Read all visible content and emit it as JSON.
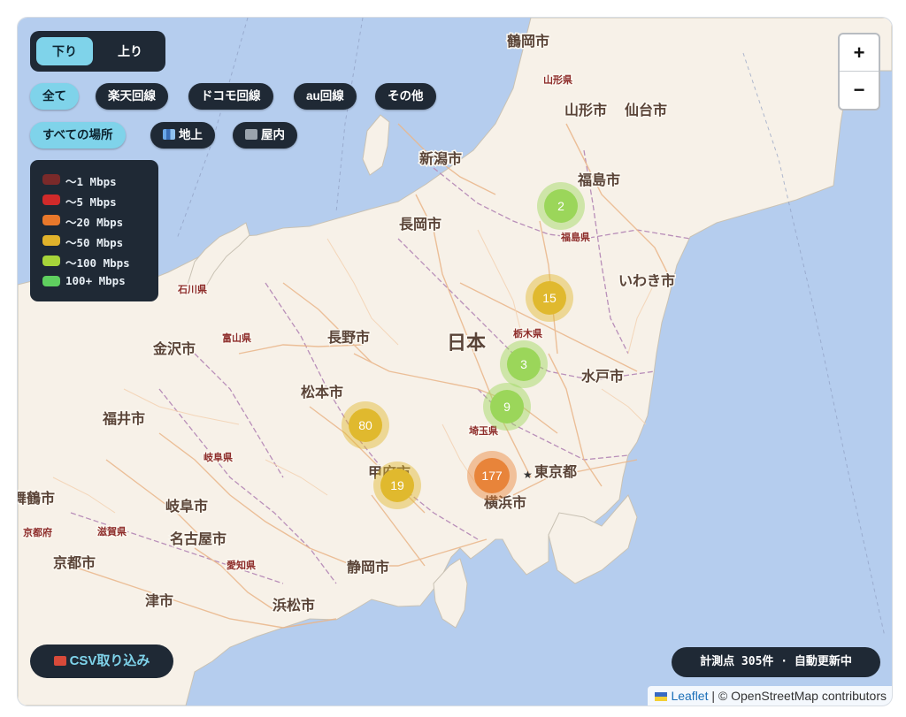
{
  "direction_toggle": {
    "download_label": "下り",
    "upload_label": "上り",
    "selected": "下り"
  },
  "carrier_filters": [
    {
      "label": "全て",
      "active": true
    },
    {
      "label": "楽天回線",
      "active": false
    },
    {
      "label": "ドコモ回線",
      "active": false
    },
    {
      "label": "au回線",
      "active": false
    },
    {
      "label": "その他",
      "active": false
    }
  ],
  "location_filters": [
    {
      "label": "すべての場所",
      "active": true,
      "icon": ""
    },
    {
      "label": "地上",
      "active": false,
      "icon": "city-buildings-icon"
    },
    {
      "label": "屋内",
      "active": false,
      "icon": "office-building-icon"
    }
  ],
  "legend": [
    {
      "label": "～1 Mbps",
      "color": "#7a2a2a"
    },
    {
      "label": "～5 Mbps",
      "color": "#d02a2a"
    },
    {
      "label": "～20 Mbps",
      "color": "#e8782b"
    },
    {
      "label": "～50 Mbps",
      "color": "#e0b22b"
    },
    {
      "label": "～100 Mbps",
      "color": "#a6d43a"
    },
    {
      "label": "100+ Mbps",
      "color": "#5fcf5f"
    }
  ],
  "zoom": {
    "in_label": "+",
    "out_label": "−"
  },
  "csv_button": {
    "label": "CSV取り込み",
    "icon": "inbox-tray-icon"
  },
  "status": {
    "text": "計測点 305件 · 自動更新中"
  },
  "attribution": {
    "leaflet": "Leaflet",
    "separator": " | © ",
    "osm": "OpenStreetMap contributors"
  },
  "map": {
    "country_label": "日本",
    "cities": [
      "鶴岡市",
      "山形市",
      "仙台市",
      "新潟市",
      "福島市",
      "長岡市",
      "いわき市",
      "長野市",
      "金沢市",
      "水戸市",
      "松本市",
      "福井市",
      "甲府市",
      "東京都",
      "横浜市",
      "岐阜市",
      "舞鶴市",
      "名古屋市",
      "京都市",
      "静岡市",
      "津市",
      "浜松市"
    ],
    "prefectures": [
      "山形県",
      "福島県",
      "石川県",
      "富山県",
      "栃木県",
      "埼玉県",
      "岐阜県",
      "京都府",
      "滋賀県",
      "愛知県"
    ],
    "clusters": [
      {
        "count": "2",
        "color": "#9bd65a"
      },
      {
        "count": "15",
        "color": "#e0b92e"
      },
      {
        "count": "3",
        "color": "#9bd65a"
      },
      {
        "count": "9",
        "color": "#9bd65a"
      },
      {
        "count": "80",
        "color": "#e0b92e"
      },
      {
        "count": "19",
        "color": "#e0b92e"
      },
      {
        "count": "177",
        "color": "#e8843a"
      }
    ]
  }
}
